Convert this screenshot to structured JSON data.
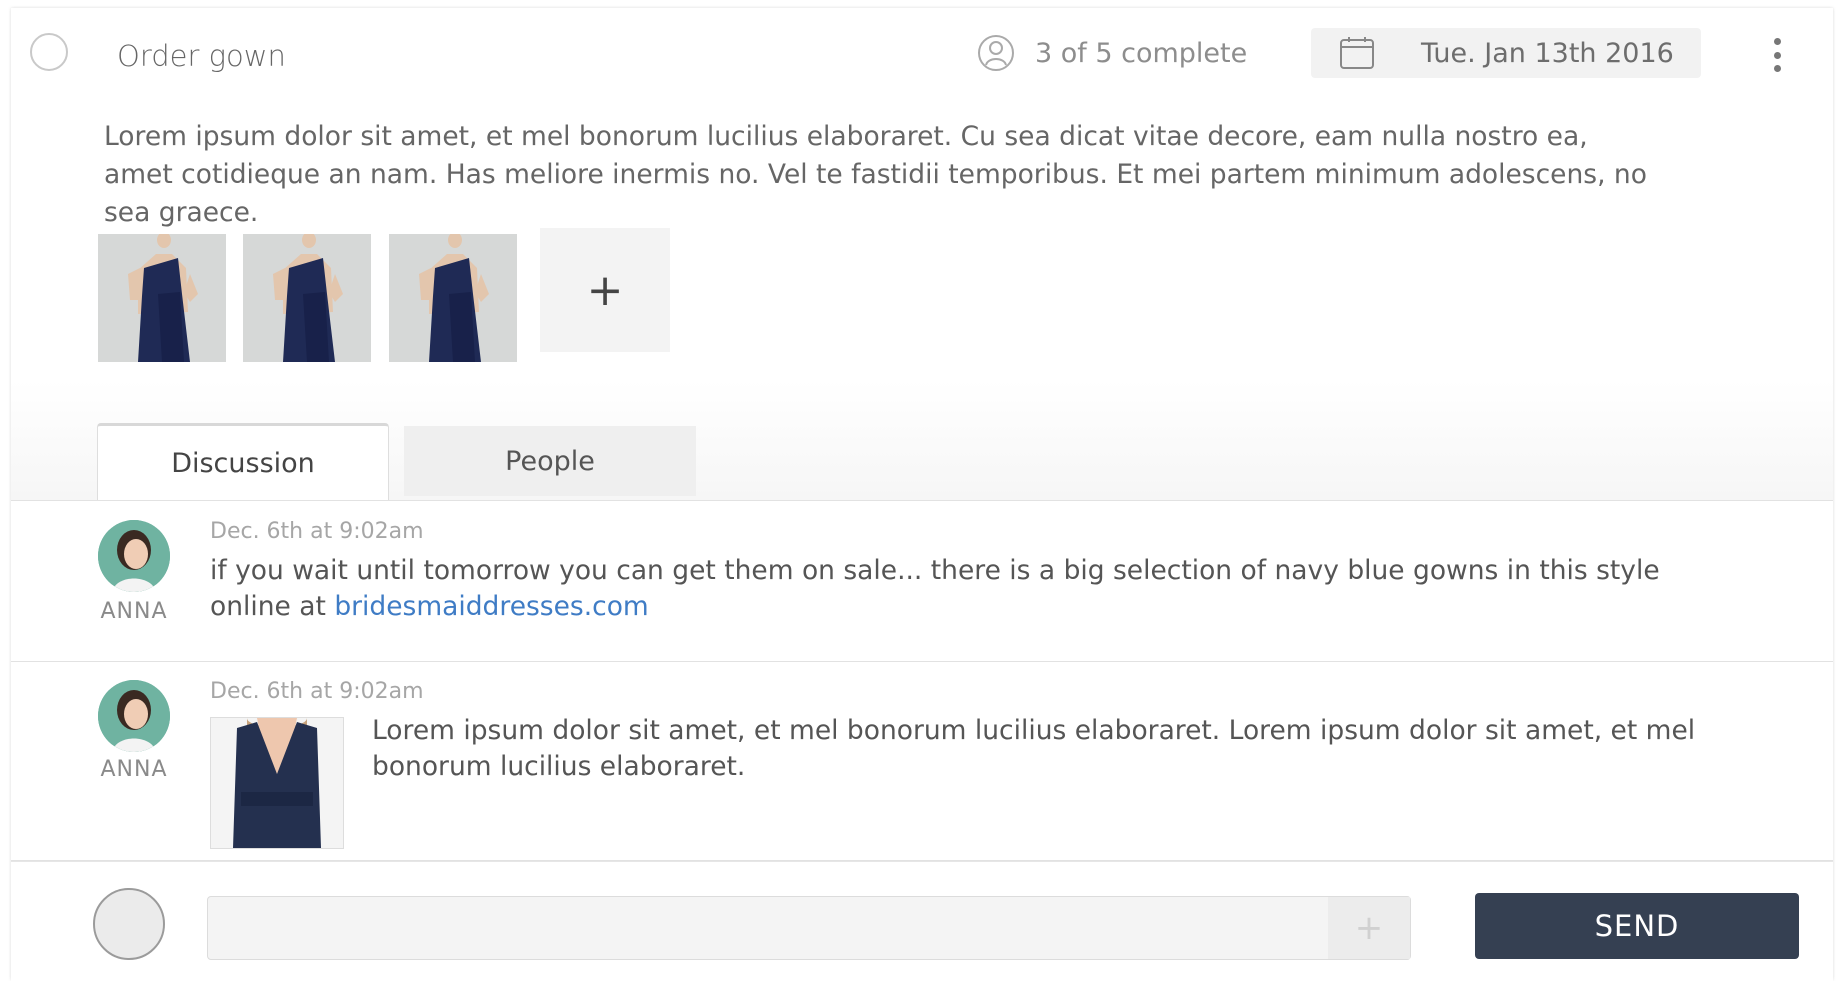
{
  "task": {
    "title": "Order gown",
    "progress_text": "3 of 5 complete",
    "progress": {
      "done": 3,
      "total": 5
    },
    "due_date": "Tue. Jan 13th 2016",
    "description": "Lorem ipsum dolor sit amet, et mel bonorum lucilius elaboraret. Cu sea dicat vitae decore, eam nulla nostro ea, amet cotidieque an nam. Has meliore inermis no. Vel te fastidii temporibus. Et mei partem minimum adolescens, no sea graece."
  },
  "attachments": {
    "add_label": "+",
    "items": [
      "navy-gown-photo",
      "navy-gown-photo",
      "navy-gown-photo"
    ]
  },
  "tabs": [
    {
      "label": "Discussion",
      "active": true
    },
    {
      "label": "People",
      "active": false
    }
  ],
  "messages": [
    {
      "author": "ANNA",
      "time": "Dec. 6th at 9:02am",
      "text_before_link": "if you wait until tomorrow you can get them on sale... there is a big selection of navy blue gowns in this style online at ",
      "link": "bridesmaiddresses.com"
    },
    {
      "author": "ANNA",
      "time": "Dec. 6th at 9:02am",
      "image": "navy-dress-photo",
      "text": "Lorem ipsum dolor sit amet, et mel bonorum lucilius elaboraret. Lorem ipsum dolor sit amet, et mel bonorum lucilius elaboraret."
    }
  ],
  "composer": {
    "placeholder": "",
    "attach_label": "+",
    "send_label": "SEND"
  },
  "colors": {
    "send_button": "#354052",
    "link": "#3f7cc5",
    "avatar_bg": "#6fb3a1"
  }
}
